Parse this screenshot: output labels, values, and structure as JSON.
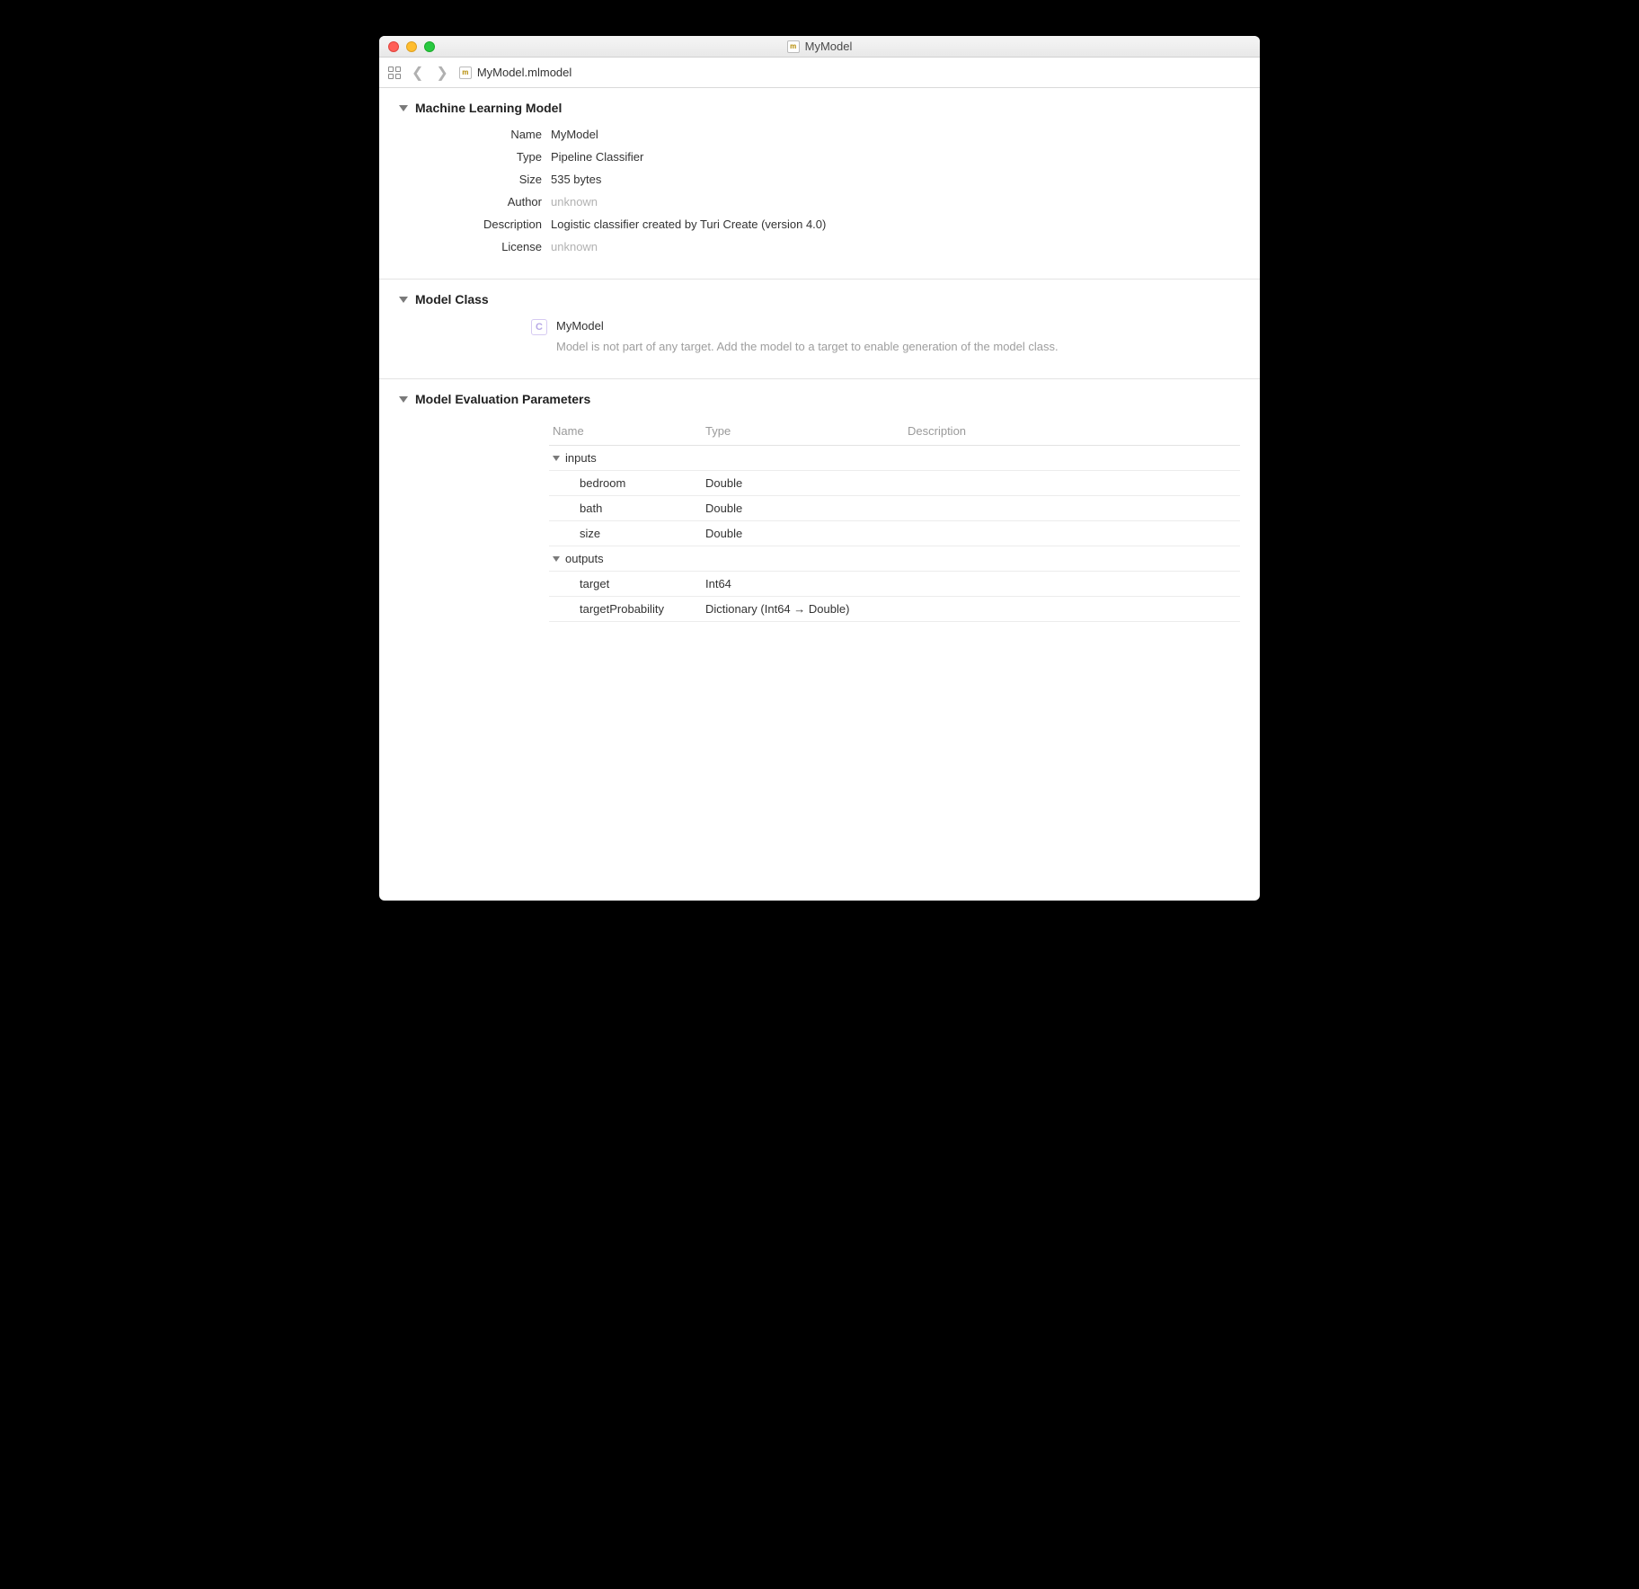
{
  "window": {
    "title": "MyModel",
    "filename": "MyModel.mlmodel"
  },
  "sections": {
    "ml_model": {
      "title": "Machine Learning Model",
      "fields": {
        "name_label": "Name",
        "name_value": "MyModel",
        "type_label": "Type",
        "type_value": "Pipeline Classifier",
        "size_label": "Size",
        "size_value": "535 bytes",
        "author_label": "Author",
        "author_value": "unknown",
        "description_label": "Description",
        "description_value": "Logistic classifier created by Turi Create (version 4.0)",
        "license_label": "License",
        "license_value": "unknown"
      }
    },
    "model_class": {
      "title": "Model Class",
      "name": "MyModel",
      "note": "Model is not part of any target. Add the model to a target to enable generation of the model class."
    },
    "eval_params": {
      "title": "Model Evaluation Parameters",
      "columns": {
        "name": "Name",
        "type": "Type",
        "description": "Description"
      },
      "groups": [
        {
          "label": "inputs",
          "rows": [
            {
              "name": "bedroom",
              "type": "Double",
              "description": ""
            },
            {
              "name": "bath",
              "type": "Double",
              "description": ""
            },
            {
              "name": "size",
              "type": "Double",
              "description": ""
            }
          ]
        },
        {
          "label": "outputs",
          "rows": [
            {
              "name": "target",
              "type": "Int64",
              "description": ""
            },
            {
              "name": "targetProbability",
              "type": "Dictionary (Int64 → Double)",
              "description": ""
            }
          ]
        }
      ]
    }
  }
}
